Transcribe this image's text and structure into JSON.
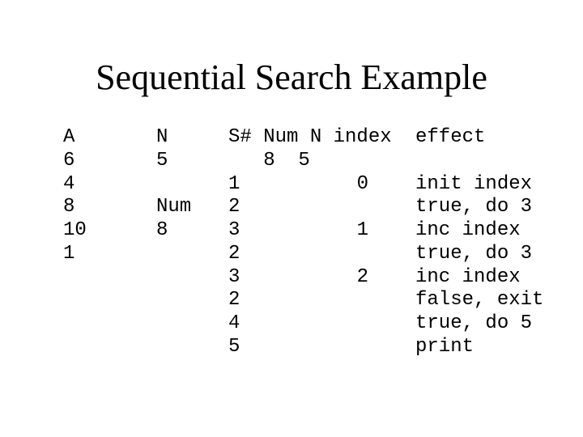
{
  "title": "Sequential Search Example",
  "array": {
    "header": "A",
    "values": [
      "6",
      "4",
      "8",
      "10",
      "1"
    ]
  },
  "variables": {
    "n_label": "N",
    "n_value": "5",
    "num_label": "Num",
    "num_value": "8"
  },
  "trace": {
    "header": "S# Num N index",
    "initial_values_row": "   8  5",
    "steps": [
      "1",
      "2",
      "3",
      "2",
      "3",
      "2",
      "4",
      "5"
    ],
    "index_values": [
      "0",
      "",
      "1",
      "",
      "2",
      "",
      "",
      ""
    ]
  },
  "effect": {
    "header": "effect",
    "values": [
      "init index",
      "true, do 3",
      "inc index",
      "true, do 3",
      "inc index",
      "false, exit",
      "true, do 5",
      "print"
    ]
  }
}
